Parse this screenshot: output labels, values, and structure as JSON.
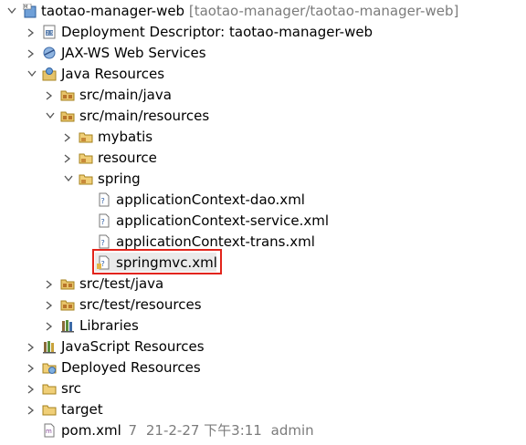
{
  "tree": {
    "project": {
      "name": "taotao-manager-web",
      "path": "[taotao-manager/taotao-manager-web]"
    },
    "deployment_descriptor": "Deployment Descriptor: taotao-manager-web",
    "jaxws": "JAX-WS Web Services",
    "java_resources": "Java Resources",
    "src_main_java": "src/main/java",
    "src_main_resources": "src/main/resources",
    "mybatis": "mybatis",
    "resource": "resource",
    "spring": "spring",
    "files": [
      "applicationContext-dao.xml",
      "applicationContext-service.xml",
      "applicationContext-trans.xml",
      "springmvc.xml"
    ],
    "src_test_java": "src/test/java",
    "src_test_resources": "src/test/resources",
    "libraries": "Libraries",
    "javascript_resources": "JavaScript Resources",
    "deployed_resources": "Deployed Resources",
    "src": "src",
    "target": "target",
    "pom": {
      "name": "pom.xml",
      "version": "7",
      "date": "21-2-27 下午3:11",
      "author": "admin"
    }
  },
  "colors": {
    "highlight_border": "#e2241b",
    "selection_bg": "#eaeaea",
    "secondary_text": "#7b7b7b"
  }
}
